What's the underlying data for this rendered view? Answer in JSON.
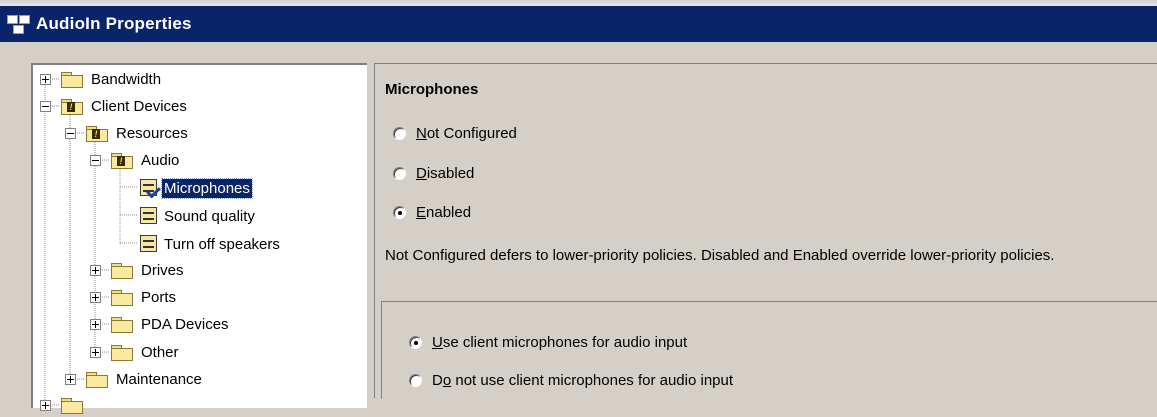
{
  "window": {
    "title": "AudioIn Properties",
    "icon": "policy-window-icon"
  },
  "tree": {
    "items": [
      {
        "label": "Bandwidth",
        "icon": "folder-icon"
      },
      {
        "label": "Client Devices",
        "icon": "folder-warning-icon"
      },
      {
        "label": "Resources",
        "icon": "folder-warning-icon"
      },
      {
        "label": "Audio",
        "icon": "folder-warning-icon"
      },
      {
        "label": "Microphones",
        "icon": "policy-checked-icon",
        "selected": true
      },
      {
        "label": "Sound quality",
        "icon": "policy-icon"
      },
      {
        "label": "Turn off speakers",
        "icon": "policy-icon"
      },
      {
        "label": "Drives",
        "icon": "folder-icon"
      },
      {
        "label": "Ports",
        "icon": "folder-icon"
      },
      {
        "label": "PDA Devices",
        "icon": "folder-icon"
      },
      {
        "label": "Other",
        "icon": "folder-icon"
      },
      {
        "label": "Maintenance",
        "icon": "folder-icon"
      }
    ]
  },
  "setting": {
    "title": "Microphones",
    "state_options": [
      {
        "mnemonic": "N",
        "rest": "ot Configured",
        "checked": false
      },
      {
        "mnemonic": "D",
        "rest": "isabled",
        "checked": false
      },
      {
        "mnemonic": "E",
        "rest": "nabled",
        "checked": true
      }
    ],
    "description": "Not Configured defers to lower-priority policies. Disabled and Enabled override lower-priority policies.",
    "input_options": [
      {
        "pre": "",
        "mnemonic": "U",
        "rest": "se client microphones for audio input",
        "checked": true
      },
      {
        "pre": "D",
        "mnemonic": "o",
        "rest": " not use client microphones for audio input",
        "checked": false
      }
    ]
  }
}
